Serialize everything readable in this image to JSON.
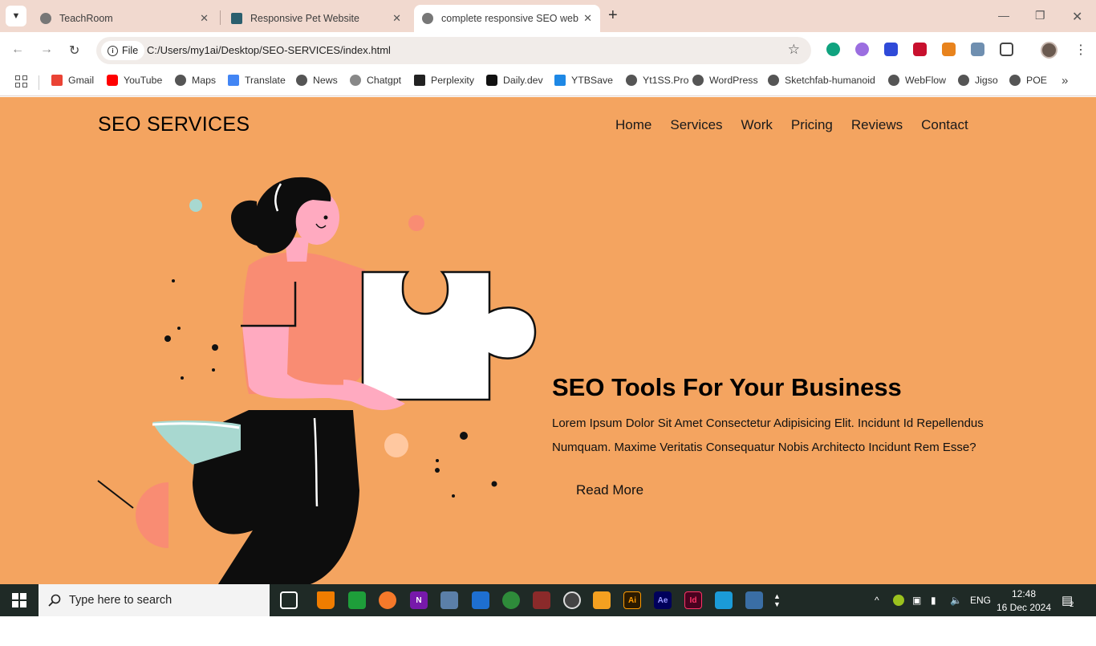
{
  "browser": {
    "tabs": [
      {
        "title": "TeachRoom",
        "active": false
      },
      {
        "title": "Responsive Pet Website",
        "active": false
      },
      {
        "title": "complete responsive SEO websi",
        "active": true
      }
    ],
    "address": {
      "chip": "File",
      "url": "C:/Users/my1ai/Desktop/SEO-SERVICES/index.html"
    },
    "bookmarks": [
      "Gmail",
      "YouTube",
      "Maps",
      "Translate",
      "News",
      "Chatgpt",
      "Perplexity",
      "Daily.dev",
      "YTBSave",
      "Yt1SS.Pro",
      "WordPress",
      "Sketchfab-humanoid",
      "WebFlow",
      "Jigso",
      "POE"
    ]
  },
  "page": {
    "logo": "SEO SERVICES",
    "nav": [
      "Home",
      "Services",
      "Work",
      "Pricing",
      "Reviews",
      "Contact"
    ],
    "hero": {
      "title": "SEO Tools For Your Business",
      "text": "Lorem Ipsum Dolor Sit Amet Consectetur Adipisicing Elit. Incidunt Id Repellendus Numquam. Maxime Veritatis Consequatur Nobis Architecto Incidunt Rem Esse?",
      "button": "Read More"
    },
    "colors": {
      "background": "#f4a460",
      "shirt": "#f98c73",
      "skin": "#ffaac0",
      "puzzle": "#ffffff"
    }
  },
  "taskbar": {
    "search_placeholder": "Type here to search",
    "language": "ENG",
    "time": "12:48",
    "date": "16 Dec 2024",
    "notifications": "2"
  }
}
